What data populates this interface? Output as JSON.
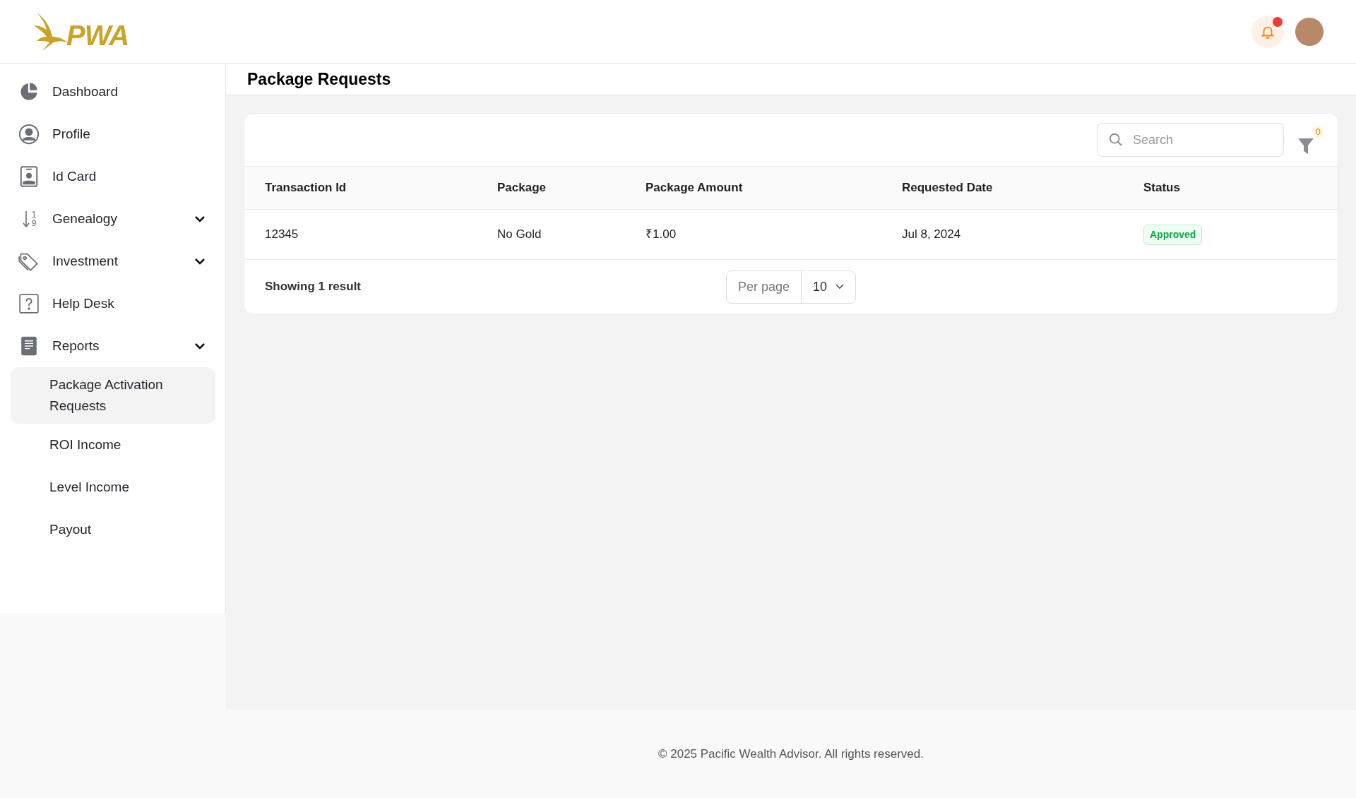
{
  "header": {
    "logo_text": "PWA",
    "notification": {
      "unread": true
    }
  },
  "sidebar": {
    "items": [
      {
        "label": "Dashboard",
        "expandable": false
      },
      {
        "label": "Profile",
        "expandable": false
      },
      {
        "label": "Id Card",
        "expandable": false
      },
      {
        "label": "Genealogy",
        "expandable": true,
        "icon_digits": [
          "1",
          "9"
        ]
      },
      {
        "label": "Investment",
        "expandable": true
      },
      {
        "label": "Help Desk",
        "expandable": false
      },
      {
        "label": "Reports",
        "expandable": true,
        "children": [
          {
            "label": "Package Activation Requests",
            "selected": true
          },
          {
            "label": "ROI Income",
            "selected": false
          },
          {
            "label": "Level Income",
            "selected": false
          },
          {
            "label": "Payout",
            "selected": false
          }
        ]
      }
    ]
  },
  "page_title": "Package Requests",
  "toolbar": {
    "search": {
      "placeholder": "Search"
    },
    "filter_count": "0"
  },
  "table": {
    "columns": [
      "Transaction Id",
      "Package",
      "Package Amount",
      "Requested Date",
      "Status"
    ],
    "rows": [
      {
        "cells": [
          "12345",
          "No Gold",
          "₹1.00",
          "Jul 8, 2024"
        ],
        "status": "Approved"
      }
    ]
  },
  "pagination": {
    "summary": "Showing 1 result",
    "per_page_label": "Per page",
    "per_page_value": "10"
  },
  "footer": "© 2025 Pacific Wealth Advisor. All rights reserved."
}
